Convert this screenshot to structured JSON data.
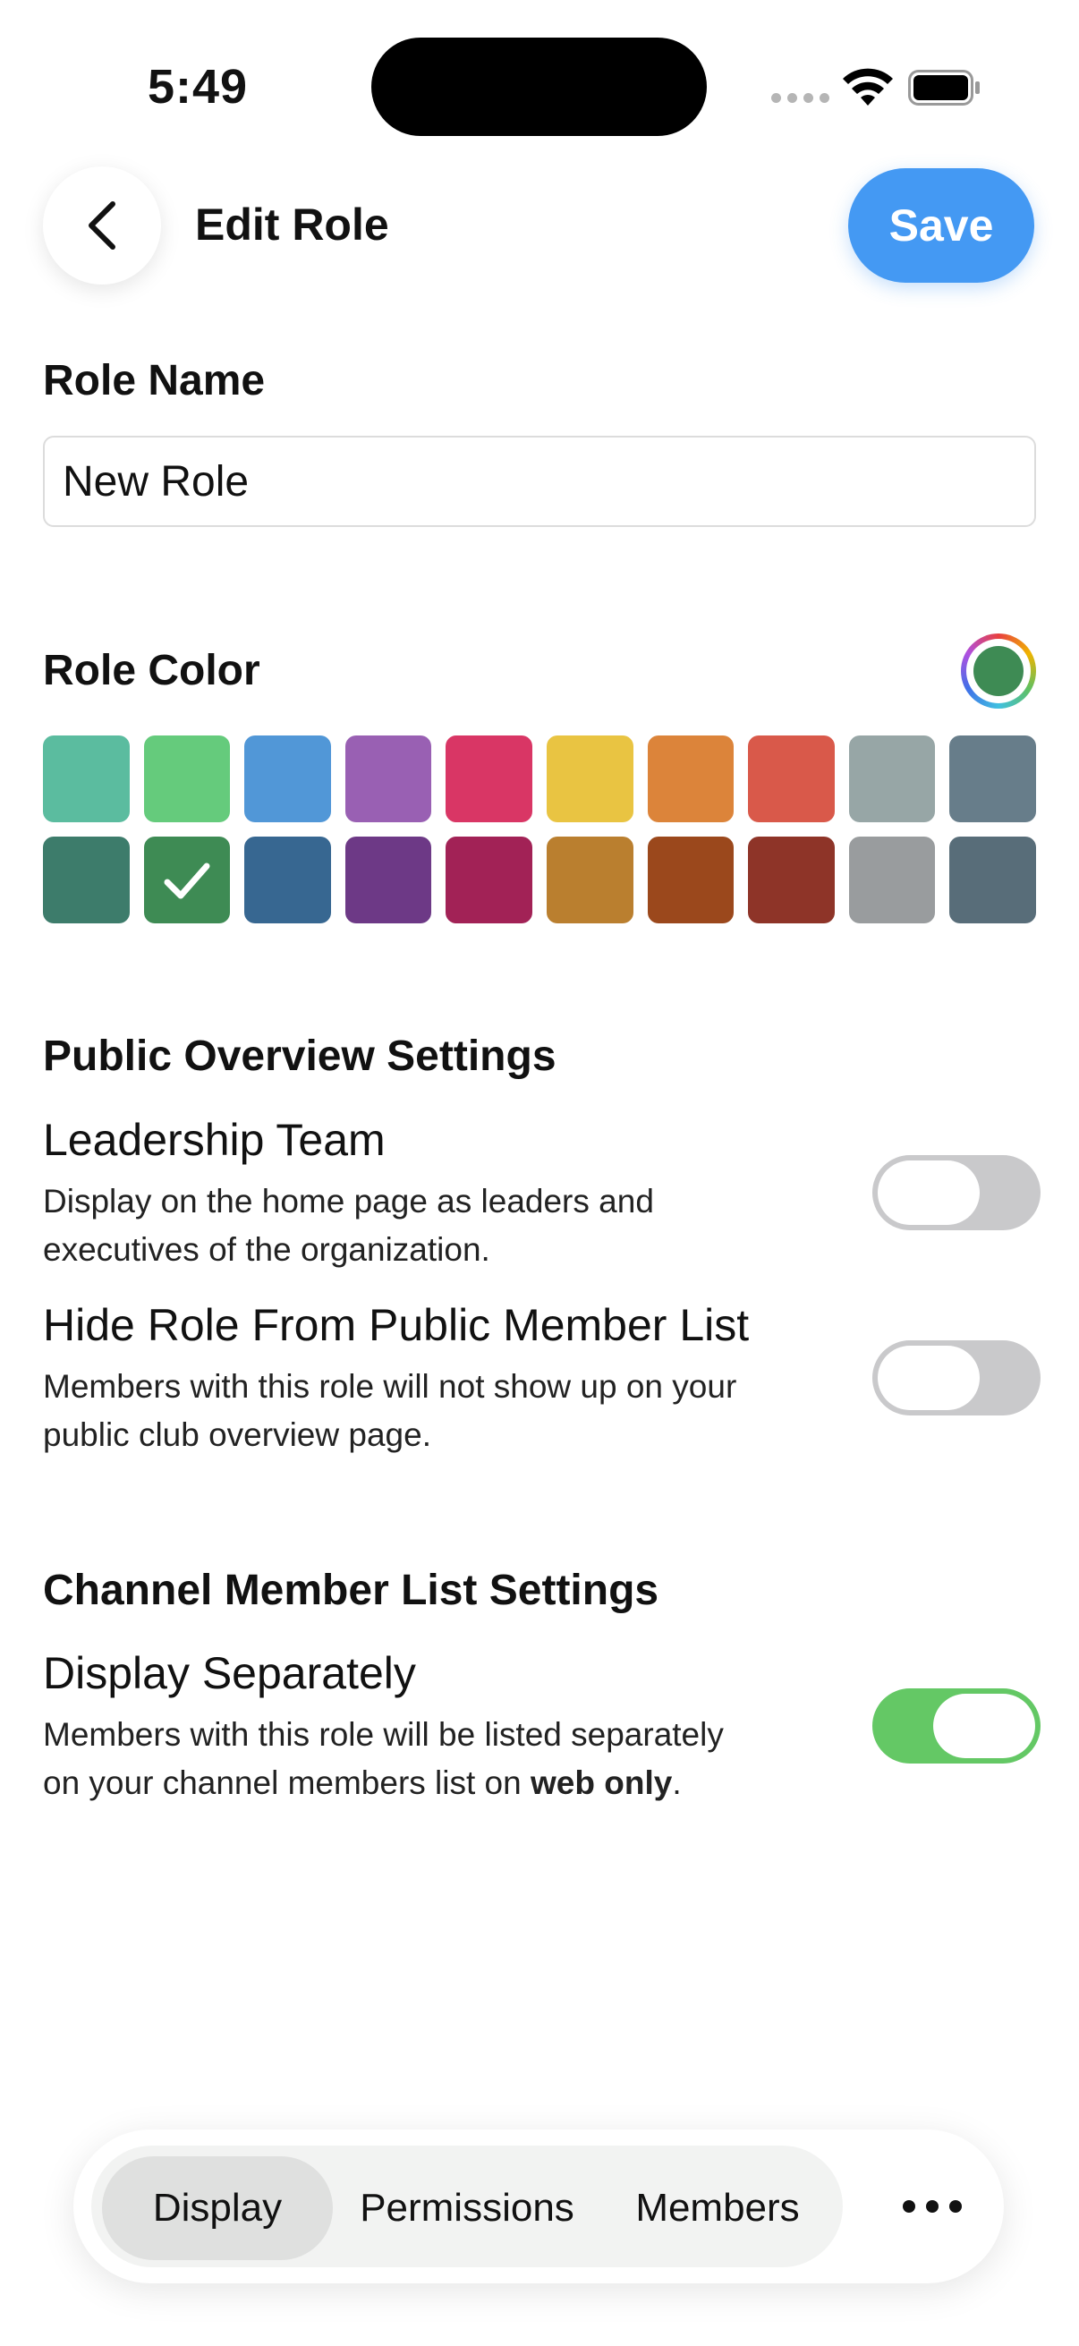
{
  "status_bar": {
    "time": "5:49"
  },
  "header": {
    "title": "Edit Role",
    "save_label": "Save"
  },
  "role_name": {
    "label": "Role Name",
    "value": "New Role"
  },
  "role_color": {
    "label": "Role Color",
    "selected_color": "#3e8b54",
    "rows": [
      [
        "#5bbc9f",
        "#65cb7c",
        "#5197d7",
        "#9960b3",
        "#d93665",
        "#e9c442",
        "#dc843a",
        "#d9594a",
        "#97a6a6",
        "#677d8a"
      ],
      [
        "#3d7c6b",
        "#3e8b54",
        "#376791",
        "#6d3986",
        "#a22256",
        "#ba7f2f",
        "#9b481c",
        "#8e3428",
        "#999c9e",
        "#586d79"
      ]
    ],
    "selected_index": [
      1,
      1
    ]
  },
  "public_overview": {
    "heading": "Public Overview Settings",
    "leadership": {
      "title": "Leadership Team",
      "desc_line1": "Display on the home page as leaders and",
      "desc_line2": "executives of the organization.",
      "enabled": false
    },
    "hide_role": {
      "title": "Hide Role From Public Member List",
      "desc_line1": "Members with this role will not show up on your",
      "desc_line2": "public club overview page.",
      "enabled": false
    }
  },
  "channel_member_list": {
    "heading": "Channel Member List Settings",
    "display_separately": {
      "title": "Display Separately",
      "desc_line1": "Members with this role will be listed separately",
      "desc_line2_prefix": "on your channel members list on ",
      "desc_line2_bold": "web only",
      "desc_line2_suffix": ".",
      "enabled": true
    }
  },
  "tabs": [
    {
      "label": "Display",
      "active": true
    },
    {
      "label": "Permissions",
      "active": false
    },
    {
      "label": "Members",
      "active": false
    }
  ],
  "icons": {
    "back": "chevron-left-icon",
    "more": "ellipsis-icon",
    "color_picker": "color-wheel-icon",
    "check": "checkmark-icon",
    "wifi": "wifi-icon",
    "battery": "battery-icon"
  }
}
